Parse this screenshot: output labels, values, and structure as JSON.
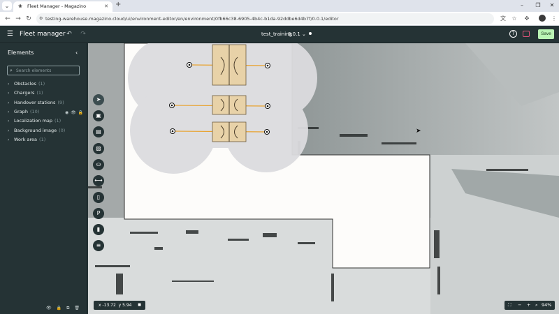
{
  "browser": {
    "tab_title": "Fleet Manager - Magazino",
    "new_tab_icon": "plus-icon",
    "url": "testing-warehouse.magazino.cloud/ui/environment-editor/en/environment/0fb66c38-6905-4b4c-b1da-92ddbe6d4b7f/0.0.1/editor"
  },
  "app": {
    "title": "Fleet manager",
    "environment_name": "test_training",
    "environment_version": "0.0.1",
    "save_label": "Save"
  },
  "sidebar": {
    "title": "Elements",
    "search_placeholder": "Search elements",
    "items": [
      {
        "label": "Obstacles",
        "count": "(1)"
      },
      {
        "label": "Chargers",
        "count": "(1)"
      },
      {
        "label": "Handover stations",
        "count": "(9)"
      },
      {
        "label": "Graph",
        "count": "(10)"
      },
      {
        "label": "Localization map",
        "count": "(1)"
      },
      {
        "label": "Background image",
        "count": "(0)"
      },
      {
        "label": "Work area",
        "count": "(1)"
      }
    ]
  },
  "tools": [
    {
      "name": "select-tool",
      "glyph": "➤"
    },
    {
      "name": "handover-station-tool",
      "glyph": "▣"
    },
    {
      "name": "rack-tool",
      "glyph": "▤"
    },
    {
      "name": "obstacle-tool",
      "glyph": "▨"
    },
    {
      "name": "waypoint-tool",
      "glyph": "⛀"
    },
    {
      "name": "edge-tool",
      "glyph": "⟷"
    },
    {
      "name": "charger-tool",
      "glyph": "▯"
    },
    {
      "name": "parking-tool",
      "glyph": "P"
    },
    {
      "name": "robot-tool",
      "glyph": "▮"
    },
    {
      "name": "station-tool",
      "glyph": "≡"
    }
  ],
  "status": {
    "x": "x -13.72",
    "y": "y 5.94",
    "zoom": "94%"
  },
  "colors": {
    "app_bg": "#253335",
    "save_green": "#b9f3b4",
    "work_area": "#fdfcfa",
    "map_unknown": "#a4a9a9",
    "rack_wood": "#e8d2a8"
  }
}
